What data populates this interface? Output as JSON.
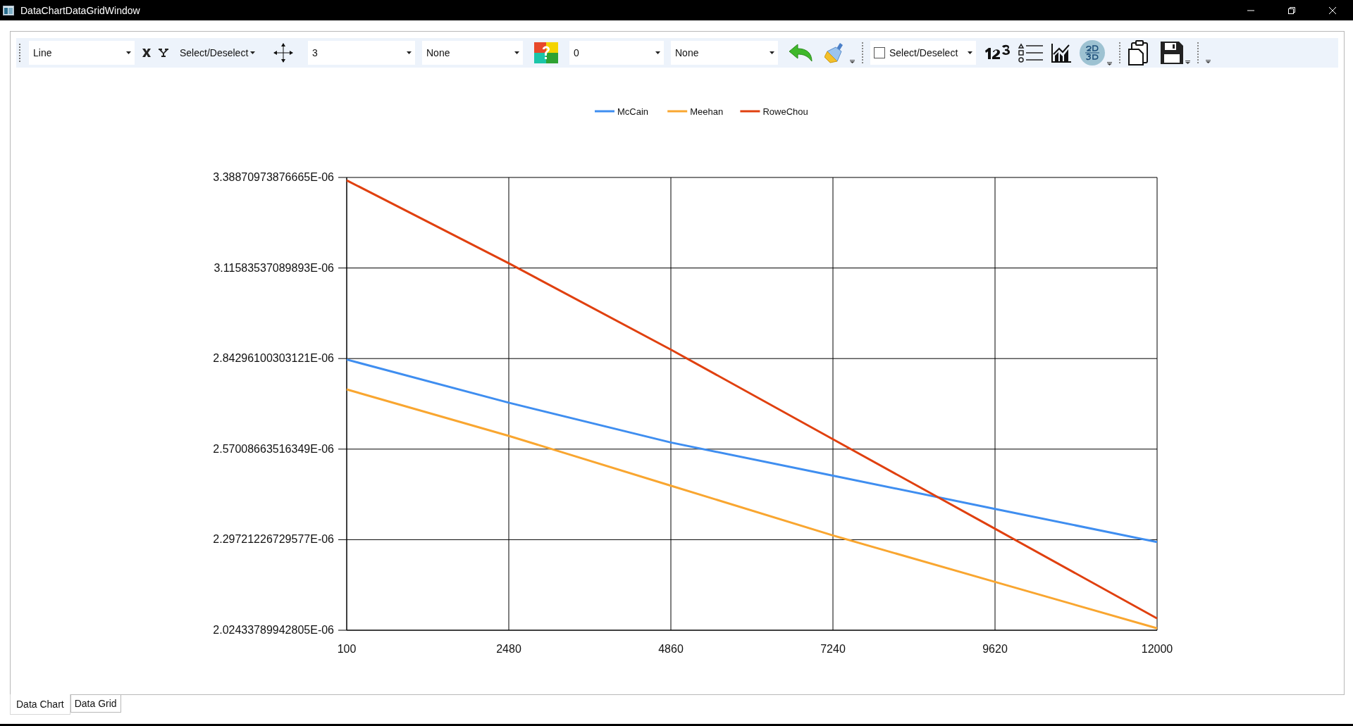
{
  "window": {
    "title": "DataChartDataGridWindow"
  },
  "toolbar": {
    "chart_type": {
      "value": "Line"
    },
    "axis_selection": {
      "value": "Select/Deselect"
    },
    "point_size": {
      "value": "3"
    },
    "marker_style": {
      "value": "None"
    },
    "palette_index": {
      "value": "0"
    },
    "label_style": {
      "value": "None"
    },
    "series_selection": {
      "label": "Select/Deselect",
      "checked": false
    }
  },
  "chart": {
    "chart_data": {
      "type": "line",
      "grid": true,
      "legend": true,
      "x": [
        100,
        2480,
        4860,
        7240,
        9620,
        12000
      ],
      "xlim": [
        100,
        12000
      ],
      "ylim": [
        2.02433789942805e-06,
        3.38870973876665e-06
      ],
      "xticks": [
        100,
        2480,
        4860,
        7240,
        9620,
        12000
      ],
      "yticks": [
        {
          "value": 2.02433789942805e-06,
          "label": "2.02433789942805E-06"
        },
        {
          "value": 2.29721226729577e-06,
          "label": "2.29721226729577E-06"
        },
        {
          "value": 2.57008663516349e-06,
          "label": "2.57008663516349E-06"
        },
        {
          "value": 2.84296100303121e-06,
          "label": "2.84296100303121E-06"
        },
        {
          "value": 3.11583537089893e-06,
          "label": "3.11583537089893E-06"
        },
        {
          "value": 3.38870973876665e-06,
          "label": "3.38870973876665E-06"
        }
      ],
      "series": [
        {
          "name": "McCain",
          "color": "#3f8ef0",
          "values": [
            2.84e-06,
            2.71e-06,
            2.59e-06,
            2.49e-06,
            2.39e-06,
            2.29e-06
          ]
        },
        {
          "name": "Meehan",
          "color": "#f9a630",
          "values": [
            2.75e-06,
            2.61e-06,
            2.46e-06,
            2.31e-06,
            2.17e-06,
            2.03e-06
          ]
        },
        {
          "name": "RoweChou",
          "color": "#e0400f",
          "values": [
            3.38e-06,
            3.13e-06,
            2.87e-06,
            2.6e-06,
            2.33e-06,
            2.06e-06
          ]
        }
      ]
    }
  },
  "tabs": [
    {
      "label": "Data Chart",
      "selected": true
    },
    {
      "label": "Data Grid",
      "selected": false
    }
  ]
}
